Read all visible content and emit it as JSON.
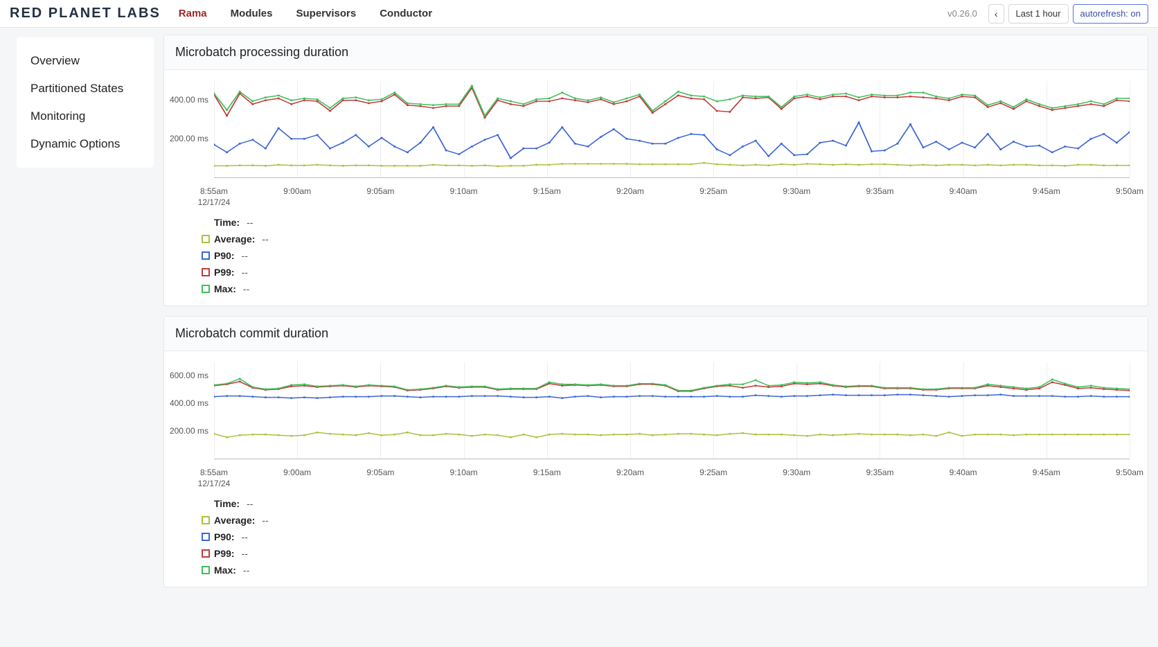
{
  "header": {
    "logo": "RED PLANET LABS",
    "nav": [
      "Rama",
      "Modules",
      "Supervisors",
      "Conductor"
    ],
    "active_nav_index": 0,
    "version": "v0.26.0",
    "time_range_label": "Last 1 hour",
    "autorefresh_label": "autorefresh: on"
  },
  "sidebar": {
    "items": [
      "Overview",
      "Partitioned States",
      "Monitoring",
      "Dynamic Options"
    ]
  },
  "series_meta": {
    "avg": {
      "label": "Average:",
      "color": "#a9c23f"
    },
    "p90": {
      "label": "P90:",
      "color": "#3c66d6"
    },
    "p99": {
      "label": "P99:",
      "color": "#c43a3a"
    },
    "max": {
      "label": "Max:",
      "color": "#3fbf5a"
    }
  },
  "x_date": "12/17/24",
  "x_labels": [
    "8:55am",
    "9:00am",
    "9:05am",
    "9:10am",
    "9:15am",
    "9:20am",
    "9:25am",
    "9:30am",
    "9:35am",
    "9:40am",
    "9:45am",
    "9:50am"
  ],
  "charts": [
    {
      "title": "Microbatch processing duration",
      "ymax": 500,
      "yticks": [
        200,
        400
      ],
      "yunit": "ms",
      "time_label": "Time:",
      "time_value": "--",
      "chart_data": {
        "type": "line",
        "x_unit": "time (HH:MMam)",
        "y_unit": "ms",
        "series": [
          {
            "name": "Average",
            "values": [
              60,
              60,
              62,
              62,
              60,
              65,
              62,
              62,
              65,
              62,
              60,
              62,
              62,
              60,
              60,
              60,
              60,
              65,
              62,
              62,
              60,
              62,
              58,
              60,
              60,
              65,
              65,
              70,
              70,
              70,
              70,
              70,
              70,
              68,
              68,
              68,
              68,
              68,
              75,
              68,
              65,
              62,
              65,
              62,
              68,
              65,
              70,
              68,
              65,
              68,
              65,
              68,
              68,
              65,
              62,
              65,
              62,
              65,
              65,
              62,
              65,
              62,
              65,
              65,
              62,
              62,
              60,
              65,
              65,
              62,
              62,
              62
            ]
          },
          {
            "name": "P90",
            "values": [
              170,
              130,
              175,
              195,
              150,
              255,
              200,
              200,
              220,
              150,
              180,
              220,
              160,
              205,
              160,
              130,
              180,
              260,
              140,
              120,
              160,
              195,
              220,
              100,
              150,
              150,
              180,
              260,
              175,
              160,
              210,
              250,
              200,
              190,
              175,
              175,
              205,
              225,
              220,
              145,
              115,
              160,
              190,
              110,
              175,
              115,
              120,
              180,
              190,
              165,
              285,
              135,
              140,
              175,
              275,
              155,
              185,
              145,
              180,
              155,
              225,
              145,
              185,
              160,
              165,
              130,
              160,
              150,
              200,
              225,
              180,
              235
            ]
          },
          {
            "name": "P99",
            "values": [
              430,
              320,
              435,
              380,
              400,
              410,
              380,
              400,
              395,
              345,
              400,
              400,
              385,
              395,
              430,
              375,
              370,
              360,
              370,
              370,
              465,
              310,
              400,
              380,
              370,
              395,
              395,
              410,
              400,
              390,
              405,
              380,
              395,
              420,
              335,
              380,
              425,
              410,
              405,
              345,
              340,
              415,
              410,
              415,
              355,
              410,
              420,
              405,
              420,
              420,
              400,
              420,
              415,
              415,
              420,
              415,
              410,
              400,
              420,
              415,
              365,
              385,
              355,
              395,
              370,
              350,
              360,
              370,
              380,
              370,
              400,
              395
            ]
          },
          {
            "name": "Max",
            "values": [
              435,
              350,
              445,
              395,
              415,
              425,
              400,
              410,
              405,
              360,
              410,
              415,
              400,
              405,
              440,
              385,
              380,
              375,
              380,
              380,
              475,
              320,
              410,
              395,
              380,
              405,
              410,
              440,
              410,
              400,
              415,
              390,
              410,
              430,
              345,
              395,
              445,
              425,
              420,
              395,
              405,
              425,
              420,
              420,
              365,
              420,
              430,
              415,
              430,
              435,
              415,
              430,
              425,
              425,
              440,
              440,
              420,
              410,
              430,
              425,
              375,
              395,
              365,
              405,
              380,
              360,
              370,
              380,
              395,
              380,
              410,
              410
            ]
          }
        ]
      },
      "legend_values": {
        "avg": "--",
        "p90": "--",
        "p99": "--",
        "max": "--"
      }
    },
    {
      "title": "Microbatch commit duration",
      "ymax": 700,
      "yticks": [
        200,
        400,
        600
      ],
      "yunit": "ms",
      "time_label": "Time:",
      "time_value": "--",
      "chart_data": {
        "type": "line",
        "x_unit": "time (HH:MMam)",
        "y_unit": "ms",
        "series": [
          {
            "name": "Average",
            "values": [
              180,
              155,
              170,
              175,
              175,
              170,
              165,
              170,
              190,
              180,
              175,
              170,
              185,
              170,
              175,
              190,
              170,
              170,
              180,
              175,
              165,
              175,
              170,
              155,
              175,
              155,
              175,
              180,
              175,
              175,
              170,
              175,
              175,
              180,
              170,
              175,
              180,
              180,
              175,
              170,
              180,
              185,
              175,
              175,
              175,
              170,
              165,
              175,
              170,
              175,
              180,
              175,
              175,
              175,
              170,
              175,
              165,
              190,
              165,
              175,
              175,
              175,
              170,
              175,
              175,
              175,
              175,
              175,
              175,
              175,
              175,
              175
            ]
          },
          {
            "name": "P90",
            "values": [
              450,
              455,
              455,
              450,
              445,
              445,
              440,
              445,
              440,
              445,
              450,
              450,
              450,
              455,
              455,
              450,
              445,
              450,
              450,
              450,
              455,
              455,
              455,
              450,
              445,
              445,
              450,
              440,
              450,
              455,
              445,
              450,
              450,
              455,
              455,
              450,
              450,
              450,
              450,
              455,
              450,
              450,
              460,
              455,
              450,
              455,
              455,
              460,
              465,
              460,
              460,
              460,
              460,
              465,
              465,
              460,
              455,
              450,
              455,
              460,
              460,
              465,
              455,
              455,
              455,
              455,
              450,
              450,
              455,
              450,
              450,
              450
            ]
          },
          {
            "name": "P99",
            "values": [
              530,
              540,
              560,
              515,
              500,
              505,
              525,
              530,
              520,
              525,
              530,
              520,
              530,
              525,
              520,
              495,
              500,
              510,
              525,
              515,
              520,
              520,
              500,
              505,
              505,
              505,
              545,
              530,
              535,
              530,
              535,
              525,
              525,
              540,
              540,
              530,
              490,
              490,
              510,
              525,
              530,
              515,
              530,
              520,
              525,
              545,
              540,
              545,
              530,
              520,
              525,
              525,
              510,
              510,
              510,
              500,
              500,
              510,
              510,
              510,
              530,
              520,
              510,
              500,
              510,
              555,
              535,
              510,
              515,
              505,
              500,
              495
            ]
          },
          {
            "name": "Max",
            "values": [
              535,
              545,
              580,
              520,
              505,
              510,
              535,
              540,
              525,
              530,
              535,
              525,
              535,
              530,
              525,
              500,
              505,
              515,
              530,
              520,
              525,
              525,
              505,
              510,
              510,
              510,
              555,
              540,
              540,
              535,
              540,
              530,
              530,
              545,
              545,
              535,
              495,
              495,
              515,
              530,
              540,
              540,
              570,
              530,
              535,
              555,
              550,
              555,
              535,
              525,
              530,
              530,
              515,
              515,
              515,
              505,
              505,
              515,
              515,
              515,
              540,
              530,
              520,
              510,
              520,
              575,
              545,
              520,
              530,
              515,
              510,
              505
            ]
          }
        ]
      },
      "legend_values": {
        "avg": "--",
        "p90": "--",
        "p99": "--",
        "max": "--"
      }
    }
  ]
}
